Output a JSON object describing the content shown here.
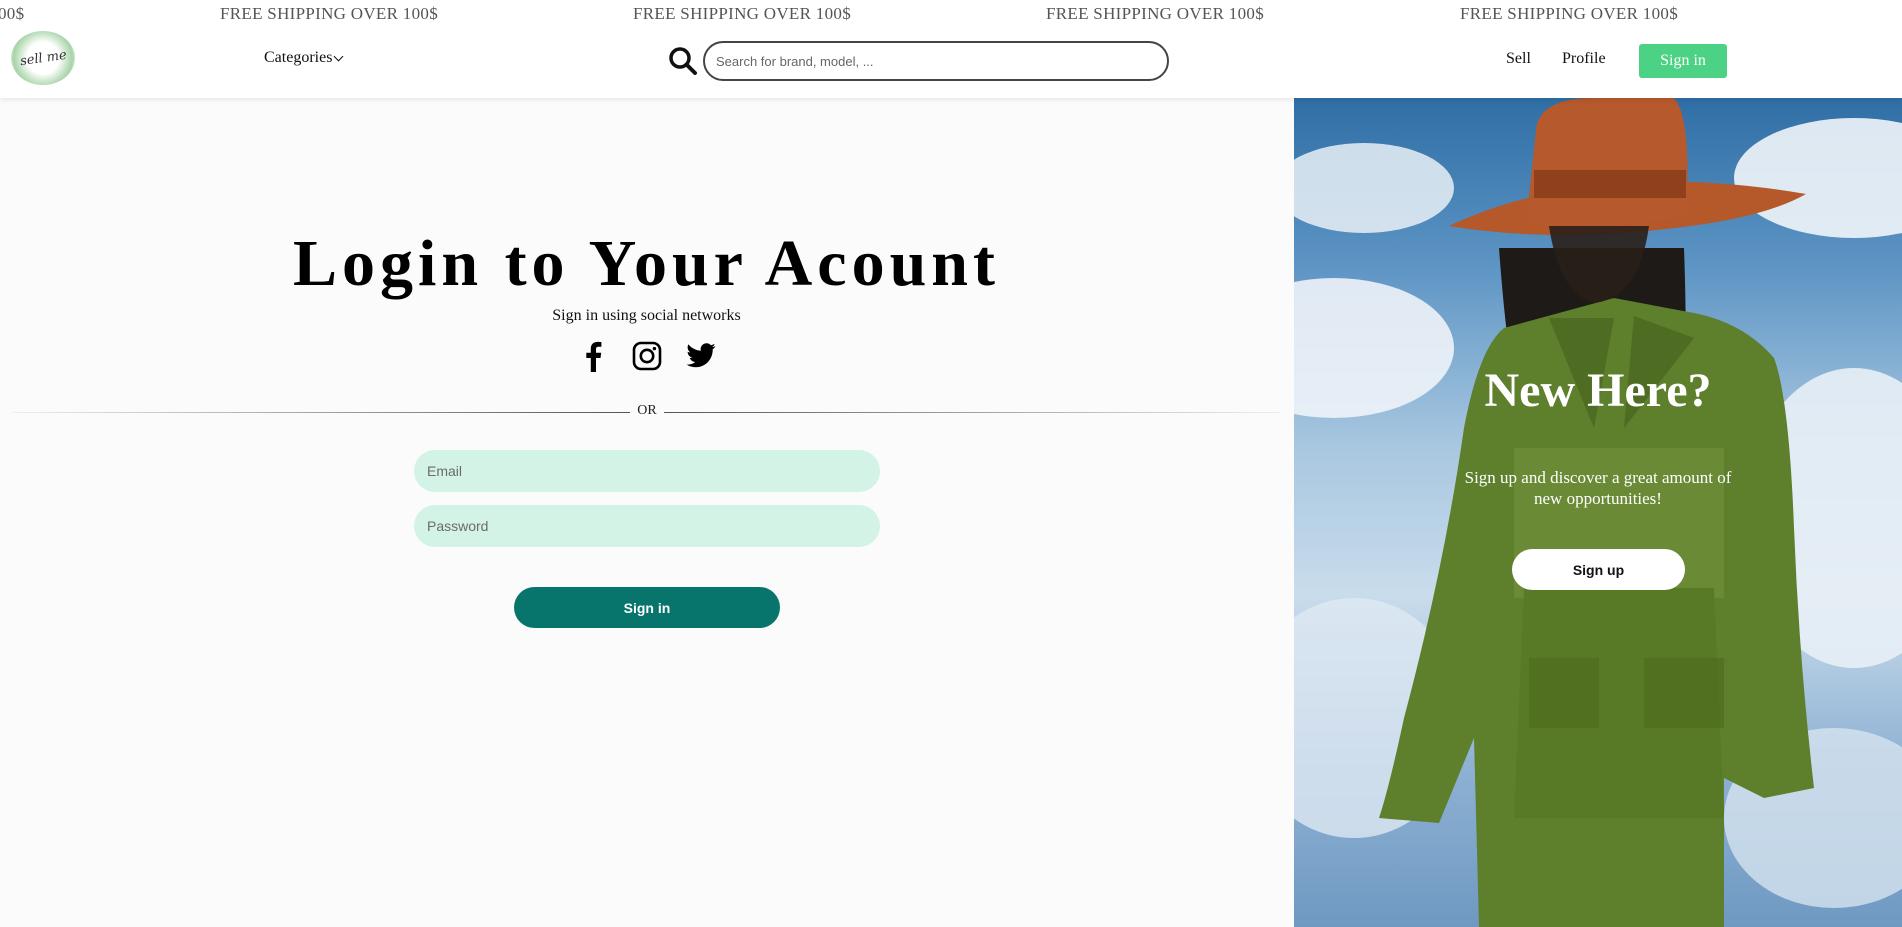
{
  "announcement": {
    "items": [
      "00$",
      "FREE SHIPPING OVER 100$",
      "FREE SHIPPING OVER 100$",
      "FREE SHIPPING OVER 100$",
      "FREE SHIPPING OVER 100$"
    ]
  },
  "header": {
    "logo_text": "sell me",
    "categories_label": "Categories",
    "search_placeholder": "Search for brand, model, ...",
    "nav": {
      "sell": "Sell",
      "profile": "Profile",
      "sign_in": "Sign in"
    }
  },
  "login": {
    "title": "Login to Your Acount",
    "social_text": "Sign in using social networks",
    "social_icons": [
      "facebook-icon",
      "instagram-icon",
      "twitter-icon"
    ],
    "or_text": "OR",
    "email_placeholder": "Email",
    "password_placeholder": "Password",
    "submit_label": "Sign in"
  },
  "promo": {
    "title": "New Here?",
    "subtitle": "Sign up and discover a great amount of new opportunities!",
    "button_label": "Sign up"
  },
  "colors": {
    "accent_green": "#4cd284",
    "primary_teal": "#08756d",
    "input_bg": "#d2f3e6"
  }
}
